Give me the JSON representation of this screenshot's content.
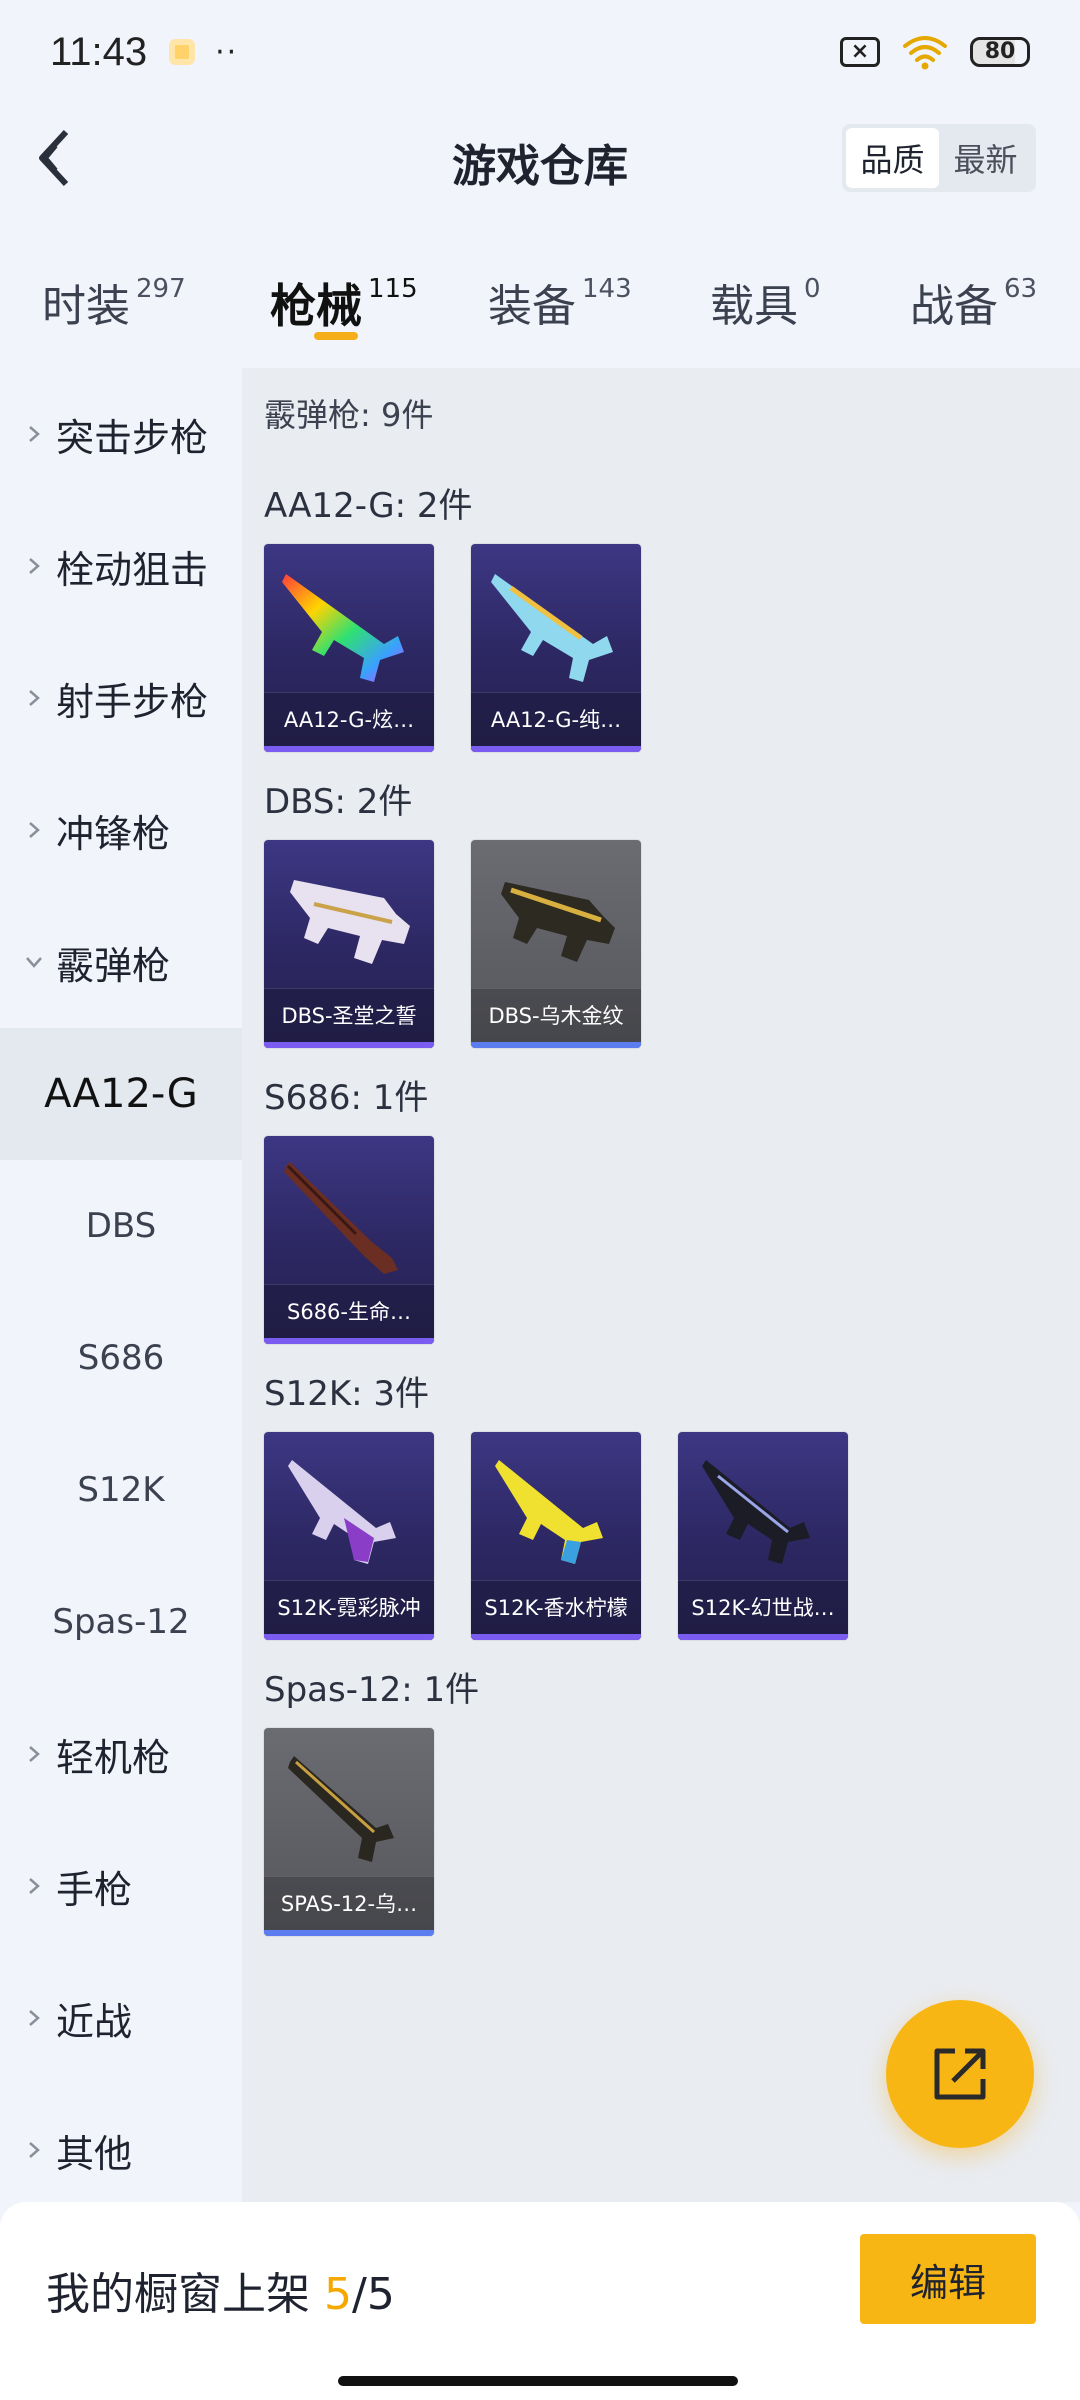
{
  "status_bar": {
    "time": "11:43",
    "more": "··",
    "battery": "80",
    "sim": "×"
  },
  "header": {
    "title": "游戏仓库",
    "sort_options": [
      "品质",
      "最新"
    ],
    "sort_active": 0
  },
  "tabs": [
    {
      "label": "时装",
      "count": "297"
    },
    {
      "label": "枪械",
      "count": "115"
    },
    {
      "label": "装备",
      "count": "143"
    },
    {
      "label": "载具",
      "count": "0"
    },
    {
      "label": "战备",
      "count": "63"
    }
  ],
  "active_tab": 1,
  "sidebar": {
    "categories": [
      {
        "label": "突击步枪"
      },
      {
        "label": "栓动狙击"
      },
      {
        "label": "射手步枪"
      },
      {
        "label": "冲锋枪"
      },
      {
        "label": "霰弹枪"
      }
    ],
    "subcategories": [
      "AA12-G",
      "DBS",
      "S686",
      "S12K",
      "Spas-12"
    ],
    "more_categories": [
      {
        "label": "轻机枪"
      },
      {
        "label": "手枪"
      },
      {
        "label": "近战"
      },
      {
        "label": "其他"
      }
    ]
  },
  "content": {
    "total": "霰弹枪: 9件",
    "groups": [
      {
        "title": "AA12-G: 2件",
        "items": [
          {
            "name": "AA12-G-炫…",
            "rarity": "purple"
          },
          {
            "name": "AA12-G-纯…",
            "rarity": "purple"
          }
        ]
      },
      {
        "title": "DBS: 2件",
        "items": [
          {
            "name": "DBS-圣堂之誓",
            "rarity": "purple"
          },
          {
            "name": "DBS-乌木金纹",
            "rarity": "gray"
          }
        ]
      },
      {
        "title": "S686: 1件",
        "items": [
          {
            "name": "S686-生命…",
            "rarity": "purple"
          }
        ]
      },
      {
        "title": "S12K: 3件",
        "items": [
          {
            "name": "S12K-霓彩脉冲",
            "rarity": "purple"
          },
          {
            "name": "S12K-香水柠檬",
            "rarity": "purple"
          },
          {
            "name": "S12K-幻世战…",
            "rarity": "purple"
          }
        ]
      },
      {
        "title": "Spas-12: 1件",
        "items": [
          {
            "name": "SPAS-12-乌…",
            "rarity": "gray"
          }
        ]
      }
    ]
  },
  "bottom_bar": {
    "label": "我的橱窗上架 ",
    "current": "5",
    "max": "/5",
    "edit_label": "编辑"
  },
  "colors": {
    "accent": "#f7b614",
    "purple_card": "#2c2761",
    "gray_card": "#55565c"
  }
}
